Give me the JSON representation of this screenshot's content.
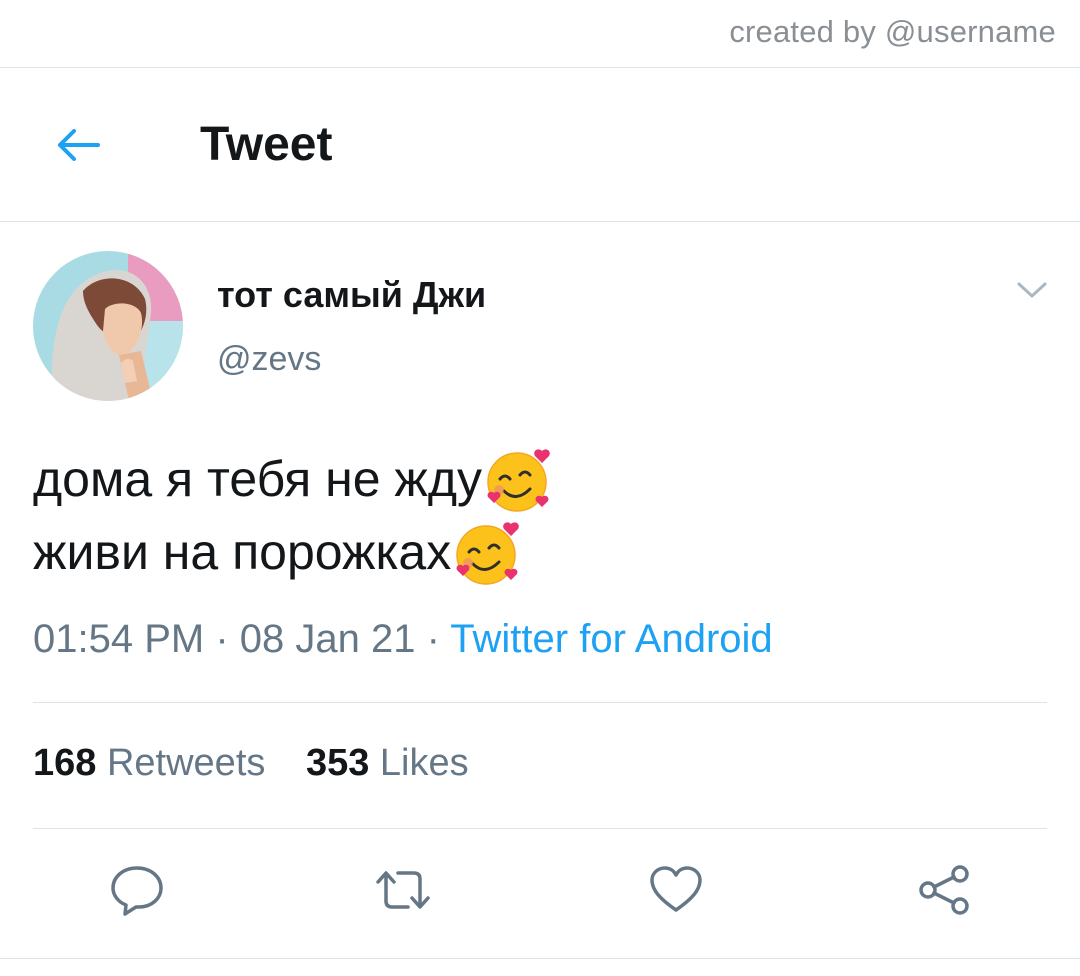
{
  "credit": "created by @username",
  "header": {
    "title": "Tweet",
    "back_icon": "arrow-left-icon"
  },
  "author": {
    "display_name": "тот самый Джи",
    "handle": "@zevs"
  },
  "tweet": {
    "lines": [
      "дома я тебя не жду",
      "живи на порожках"
    ],
    "emoji": "smiling-face-with-hearts-icon"
  },
  "meta": {
    "time": "01:54 PM",
    "sep1": " · ",
    "date": "08 Jan 21",
    "sep2": " · ",
    "source": "Twitter for Android"
  },
  "stats": {
    "retweets_count": "168",
    "retweets_label": "Retweets",
    "likes_count": "353",
    "likes_label": "Likes"
  },
  "actions": {
    "reply_icon": "reply-icon",
    "retweet_icon": "retweet-icon",
    "like_icon": "heart-icon",
    "share_icon": "share-icon"
  },
  "colors": {
    "accent": "#1da1f2",
    "text_primary": "#14171a",
    "text_secondary": "#657786",
    "divider": "#dfe3e6"
  }
}
